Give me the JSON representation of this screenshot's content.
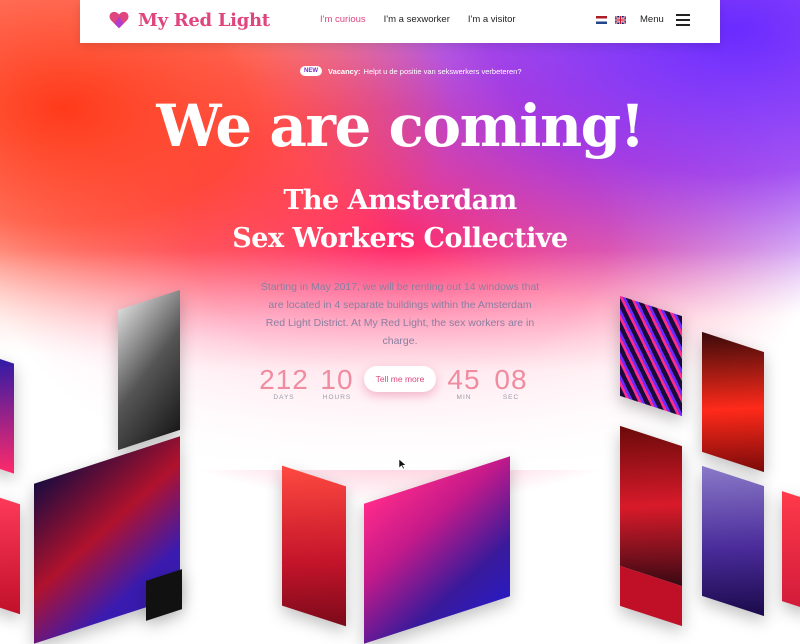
{
  "brand": {
    "name": "My Red Light"
  },
  "nav": {
    "items": [
      {
        "label": "I'm curious",
        "active": true
      },
      {
        "label": "I'm a sexworker",
        "active": false
      },
      {
        "label": "I'm a visitor",
        "active": false
      }
    ],
    "languages": [
      "dutch-flag-icon",
      "uk-flag-icon"
    ],
    "menu_label": "Menu"
  },
  "vacancy": {
    "badge": "NEW",
    "lead": "Vacancy:",
    "text": "Helpt u de positie van sekswerkers verbeteren?"
  },
  "hero": {
    "title": "We are coming!",
    "subtitle_line1": "The Amsterdam",
    "subtitle_line2": "Sex Workers Collective",
    "description": "Starting in May 2017, we will be renting out 14 windows that are located in 4 separate buildings within the Amsterdam Red Light District. At My Red Light, the sex workers are in charge."
  },
  "countdown": {
    "days": {
      "value": "212",
      "label": "DAYS"
    },
    "hours": {
      "value": "10",
      "label": "HOURS"
    },
    "min": {
      "value": "45",
      "label": "MIN"
    },
    "sec": {
      "value": "08",
      "label": "SEC"
    },
    "button_label": "Tell me more"
  },
  "colors": {
    "accent": "#e0467e",
    "red": "#ff3a1a",
    "purple": "#7a2bff"
  }
}
